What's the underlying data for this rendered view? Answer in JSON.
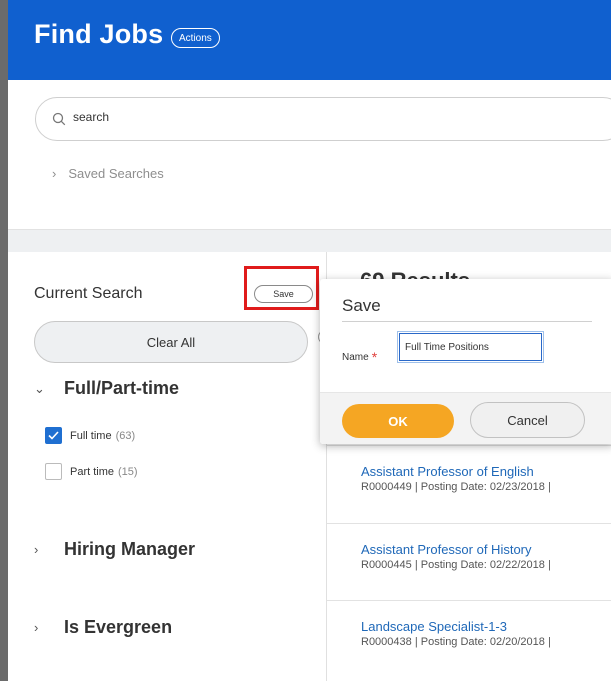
{
  "header": {
    "title": "Find Jobs",
    "actions_label": "Actions"
  },
  "search": {
    "placeholder": "search",
    "saved_searches_label": "Saved Searches"
  },
  "filters": {
    "current_search_label": "Current Search",
    "save_label": "Save",
    "clear_all_label": "Clear All",
    "facets": [
      {
        "label": "Full/Part-time",
        "expanded": true,
        "options": [
          {
            "label": "Full time",
            "count": "(63)",
            "checked": true
          },
          {
            "label": "Part time",
            "count": "(15)",
            "checked": false
          }
        ]
      },
      {
        "label": "Hiring Manager",
        "expanded": false
      },
      {
        "label": "Is Evergreen",
        "expanded": false
      }
    ]
  },
  "results": {
    "heading": "69 Results",
    "items": [
      {
        "title": "Assistant Professor of English",
        "meta": "R0000449  |  Posting Date: 02/23/2018  |"
      },
      {
        "title": "Assistant Professor of History",
        "meta": "R0000445  |  Posting Date: 02/22/2018  |"
      },
      {
        "title": "Landscape Specialist-1-3",
        "meta": "R0000438  |  Posting Date: 02/20/2018  |"
      }
    ]
  },
  "save_dialog": {
    "title": "Save",
    "name_label": "Name",
    "required_marker": "*",
    "name_value": "Full Time Positions",
    "ok_label": "OK",
    "cancel_label": "Cancel"
  },
  "colors": {
    "header": "#1060cf",
    "accent": "#f5a623",
    "link": "#1f68b8",
    "checkbox": "#1f6fd1",
    "highlight": "#e01b1b"
  },
  "icons": [
    "search-icon",
    "chevron-right-icon",
    "chevron-down-icon",
    "checkmark-icon",
    "collapse-arrow-icon"
  ]
}
